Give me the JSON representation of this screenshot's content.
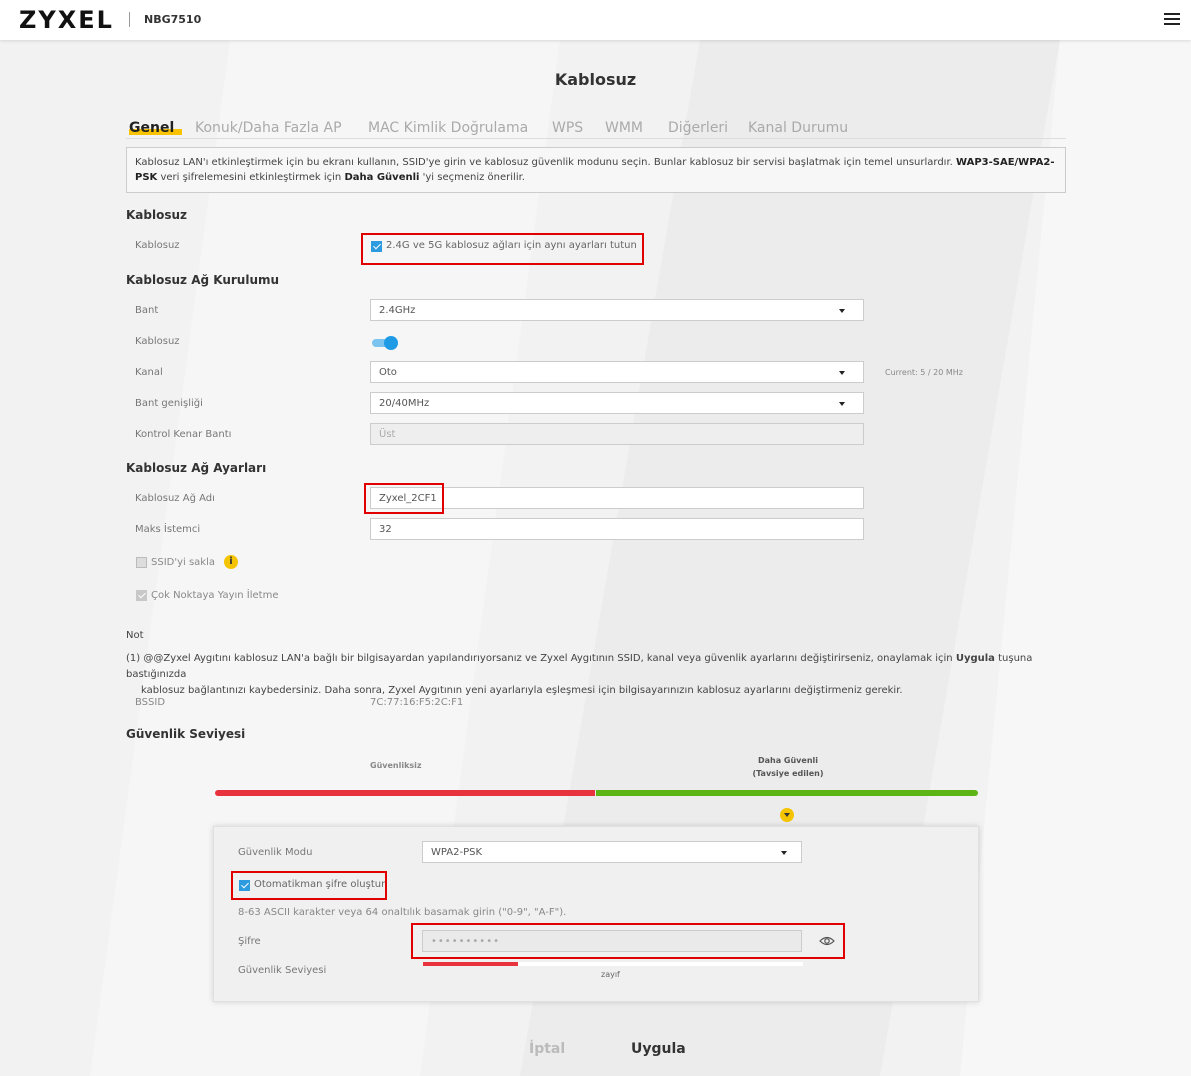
{
  "header": {
    "brand": "ZYXEL",
    "model": "NBG7510"
  },
  "page_title": "Kablosuz",
  "tabs": [
    {
      "label": "Genel",
      "active": true
    },
    {
      "label": "Konuk/Daha Fazla AP"
    },
    {
      "label": "MAC Kimlik Doğrulama"
    },
    {
      "label": "WPS"
    },
    {
      "label": "WMM"
    },
    {
      "label": "Diğerleri"
    },
    {
      "label": "Kanal Durumu"
    }
  ],
  "info": {
    "part1": "Kablosuz LAN'ı etkinleştirmek için bu ekranı kullanın, SSID'ye girin ve kablosuz güvenlik modunu seçin. Bunlar kablosuz bir servisi başlatmak için temel unsurlardır. ",
    "bold1": "WAP3-SAE/WPA2-PSK",
    "part2": " veri şifrelemesini etkinleştirmek için ",
    "bold2": "Daha Güvenli",
    "part3": " 'yi seçmeniz önerilir."
  },
  "wireless": {
    "heading": "Kablosuz",
    "label": "Kablosuz",
    "same_settings": "2.4G ve 5G kablosuz ağları için aynı ayarları tutun"
  },
  "setup": {
    "heading": "Kablosuz Ağ Kurulumu",
    "band_label": "Bant",
    "band_value": "2.4GHz",
    "wireless_label": "Kablosuz",
    "channel_label": "Kanal",
    "channel_value": "Oto",
    "channel_current": "Current: 5 / 20 MHz",
    "bandwidth_label": "Bant genişliği",
    "bandwidth_value": "20/40MHz",
    "control_label": "Kontrol Kenar Bantı",
    "control_value": "Üst"
  },
  "network": {
    "heading": "Kablosuz Ağ Ayarları",
    "ssid_label": "Kablosuz Ağ Adı",
    "ssid_value": "Zyxel_2CF1",
    "max_label": "Maks İstemci",
    "max_value": "32",
    "hide_ssid": "SSID'yi sakla",
    "multicast": "Çok Noktaya Yayın İletme"
  },
  "note": {
    "heading": "Not",
    "line1a": "(1) @@Zyxel Aygıtını kablosuz LAN'a bağlı bir bilgisayardan yapılandırıyorsanız ve Zyxel Aygıtının SSID, kanal veya güvenlik ayarlarını değiştirirseniz, onaylamak için ",
    "line1b": "Uygula",
    "line1c": " tuşuna bastığınızda",
    "line2": "kablosuz bağlantınızı kaybedersiniz. Daha sonra, Zyxel Aygıtının yeni ayarlarıyla eşleşmesi için bilgisayarınızın kablosuz ayarlarını değiştirmeniz gerekir."
  },
  "bssid": {
    "label": "BSSID",
    "value": "7C:77:16:F5:2C:F1"
  },
  "security": {
    "heading": "Güvenlik Seviyesi",
    "insecure": "Güvenliksiz",
    "secure_line1": "Daha Güvenli",
    "secure_line2": "(Tavsiye edilen)",
    "mode_label": "Güvenlik Modu",
    "mode_value": "WPA2-PSK",
    "auto_pw": "Otomatikman şifre oluştur",
    "hint": "8-63 ASCII karakter veya 64 onaltılık basamak girin (\"0-9\", \"A-F\").",
    "pw_label": "Şifre",
    "pw_value": "••••••••••",
    "level_label": "Güvenlik Seviyesi",
    "strength_text": "zayıf",
    "strength_fraction": 0.25
  },
  "buttons": {
    "cancel": "İptal",
    "apply": "Uygula"
  },
  "colors": {
    "accent": "#f9c300",
    "checkbox": "#2d9be0",
    "danger": "#e8333f",
    "ok": "#5cb514",
    "highlight": "#e00000"
  }
}
